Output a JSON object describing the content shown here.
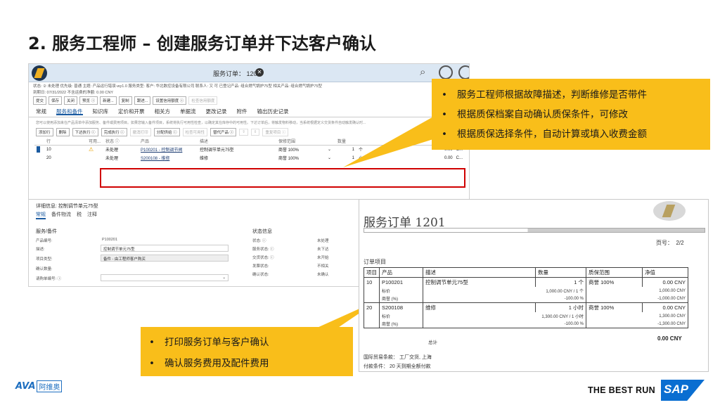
{
  "slide": {
    "title": "2. 服务工程师 – 创建服务订单并下达客户确认"
  },
  "app": {
    "window_title": "服务订单： 1201",
    "header_lines": [
      "状态: ② 未处理   优先级: 普通   主题: 产品运行错误-wy1.0   服务类型:     客户: 华北数控设备有限公司   联系人: 又 可   已登记产品: 组合燃气锅炉75型   相关产品: 组合燃气锅炉75型",
      "到期日: 07/31/2022   不含运费的净额: 0.00 CNY"
    ],
    "toolbar": [
      "提交",
      "保存",
      "关闭",
      "预览 ⓘ",
      "新建...",
      "复制",
      "跟进...",
      "设置信用额度 ⓘ",
      "检查信用额度"
    ],
    "tabs": [
      {
        "label": "常规"
      },
      {
        "label": "服务和备件"
      },
      {
        "label": "知识库"
      },
      {
        "label": "定价和开票"
      },
      {
        "label": "相关方"
      },
      {
        "label": "单据流"
      },
      {
        "label": "更改记录"
      },
      {
        "label": "附件"
      },
      {
        "label": "输出历史记录"
      }
    ],
    "info_text": "您可以使用添加来在产品清单中添加服务、备件或费用项目。如果您输入备件项目，系统将执行可用性检查，以确定其在库存中的可用性。下达订单后，将触发物料移动，当系统根据定义交货条件自动触发确认时...",
    "item_toolbar": [
      "添加行",
      "删除",
      "下达执行 ⓘ",
      "完成执行 ⓘ",
      "撤消打印",
      "分配供给 ⓘ",
      "检查可用性",
      "替代产品 ⓘ",
      "⇧",
      "⇩",
      "重复项目 ⓘ"
    ],
    "items_header": [
      "行",
      "可用...",
      "状态 ⓘ",
      "产品",
      "描述",
      "保修范围",
      "",
      "",
      "数量",
      "",
      "净值"
    ],
    "items": [
      {
        "line": "10",
        "status": "未处理",
        "product": "P100201 - 控制调节阀",
        "description": "控制调节单元75型",
        "warranty": "商誉 100%",
        "qty": "1",
        "unit": "个",
        "net": "0.00",
        "curr": "C..."
      },
      {
        "line": "20",
        "status": "未处理",
        "product": "S200108 - 维修",
        "description": "维修",
        "warranty": "商誉 100%",
        "qty": "1",
        "unit": "小时",
        "net": "0.00",
        "curr": "C..."
      }
    ],
    "detail": {
      "title": "详细信息: 控制调节单元75型",
      "tabs": [
        "常规",
        "备件物流",
        "税",
        "注释"
      ],
      "section_left": "服务/备件",
      "section_right": "状态信息",
      "left_fields": [
        {
          "label": "产品编号:",
          "value": "P100201"
        },
        {
          "label": "描述:",
          "value": "控制调节单元75型"
        },
        {
          "label": "项目类型:",
          "value": "备件 - 由工程师客户购买"
        },
        {
          "label": "确认数量:",
          "value": ""
        },
        {
          "label": "请购单编号: ⓘ",
          "value": ""
        }
      ],
      "right_fields": [
        {
          "label": "状态: ⓘ",
          "value": "未处理"
        },
        {
          "label": "服务状态: ⓘ",
          "value": "未下达"
        },
        {
          "label": "交货状态: ⓘ",
          "value": "未开始"
        },
        {
          "label": "发票状态:",
          "value": "不相关"
        },
        {
          "label": "确认状态:",
          "value": "未确认"
        }
      ]
    }
  },
  "callout_top": [
    "服务工程师根据故障描述，判断维修是否带件",
    "根据质保档案自动确认质保条件，可修改",
    "根据质保选择条件，自动计算或填入收费金额"
  ],
  "callout_bottom": [
    "打印服务订单与客户确认",
    "确认服务费用及配件费用"
  ],
  "print": {
    "title": "服务订单 1201",
    "page_label": "页号：",
    "page_value": "2/2",
    "section": "订单项目",
    "headers": [
      "项目",
      "产品",
      "描述",
      "数量",
      "质保范围",
      "净值"
    ],
    "rows": [
      {
        "item": "10",
        "product": "P100201",
        "desc": "控制调节单元75型",
        "qty": "1 个",
        "warranty": "商誉 100%",
        "net": "0.00 CNY",
        "subs": [
          {
            "label": "标价",
            "a": "1,000.00 CNY / 1 个",
            "b": "1,000.00 CNY"
          },
          {
            "label": "商誉 (%)",
            "a": "-100.00 %",
            "b": "-1,000.00 CNY"
          }
        ]
      },
      {
        "item": "20",
        "product": "S200108",
        "desc": "维修",
        "qty": "1 小时",
        "warranty": "商誉 100%",
        "net": "0.00 CNY",
        "subs": [
          {
            "label": "标价",
            "a": "1,300.00 CNY / 1 小时",
            "b": "1,300.00 CNY"
          },
          {
            "label": "商誉 (%)",
            "a": "-100.00 %",
            "b": "-1,300.00 CNY"
          }
        ]
      }
    ],
    "total_label": "总计",
    "total_value": "0.00 CNY",
    "incoterms": "国际贸易条款：  工厂交货, 上海",
    "payment": "付款条件：  20 天到期全额付款"
  },
  "brand": {
    "ava_mark": "AVA",
    "ava_cn": "阿维奥",
    "best_run": "THE BEST RUN",
    "sap": "SAP"
  }
}
